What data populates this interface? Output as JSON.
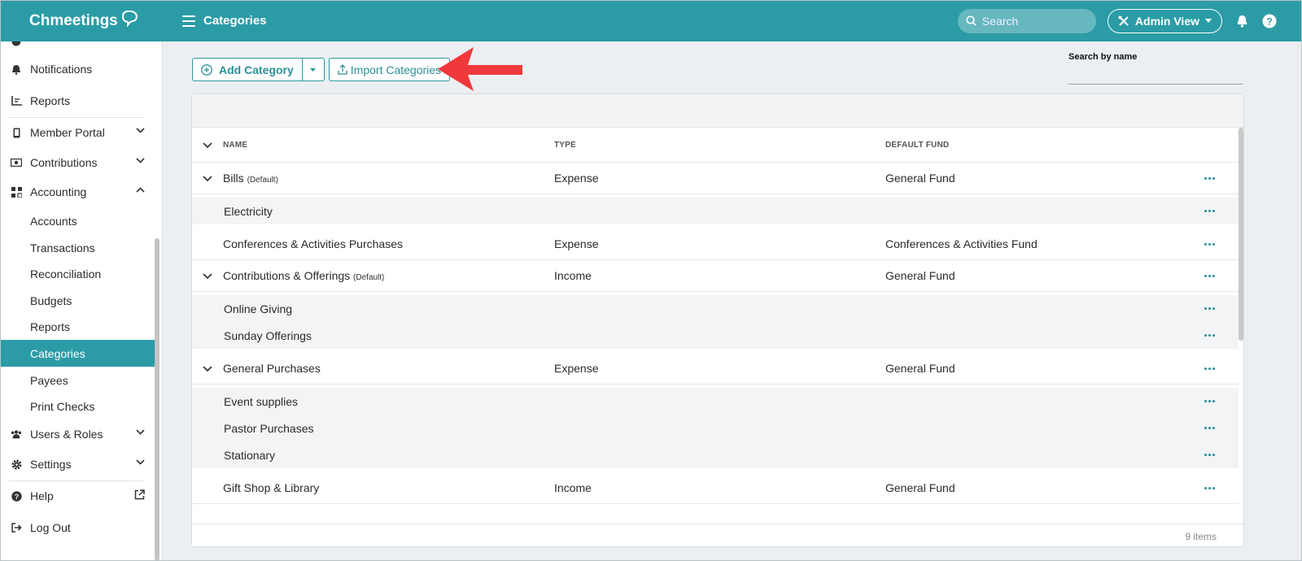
{
  "app": {
    "brand": "Chmeetings",
    "page_title": "Categories"
  },
  "topbar": {
    "search_placeholder": "Search",
    "admin_view_label": "Admin View"
  },
  "sidebar": {
    "items": [
      {
        "label": "Notifications",
        "icon": "bell-icon"
      },
      {
        "label": "Reports",
        "icon": "chart-icon"
      },
      {
        "label": "Member Portal",
        "icon": "phone-icon"
      },
      {
        "label": "Contributions",
        "icon": "cash-icon"
      },
      {
        "label": "Accounting",
        "icon": "grid-icon"
      }
    ],
    "accounting_sub": [
      "Accounts",
      "Transactions",
      "Reconciliation",
      "Budgets",
      "Reports",
      "Categories",
      "Payees",
      "Print Checks"
    ],
    "lower_items": [
      {
        "label": "Users & Roles",
        "icon": "users-icon"
      },
      {
        "label": "Settings",
        "icon": "gear-icon"
      },
      {
        "label": "Help",
        "icon": "help-icon"
      },
      {
        "label": "Log Out",
        "icon": "logout-icon"
      }
    ]
  },
  "toolbar": {
    "add_label": "Add Category",
    "import_label": "Import Categories"
  },
  "search_by_name": {
    "label": "Search by name",
    "value": ""
  },
  "table": {
    "headers": {
      "name": "NAME",
      "type": "TYPE",
      "fund": "DEFAULT FUND"
    },
    "rows": [
      {
        "kind": "parent",
        "name": "Bills",
        "tag": "(Default)",
        "type": "Expense",
        "fund": "General Fund",
        "expandable": true
      },
      {
        "kind": "child",
        "name": "Electricity",
        "type": "",
        "fund": ""
      },
      {
        "kind": "parent",
        "name": "Conferences & Activities Purchases",
        "tag": "",
        "type": "Expense",
        "fund": "Conferences & Activities Fund",
        "expandable": false
      },
      {
        "kind": "parent",
        "name": "Contributions & Offerings",
        "tag": "(Default)",
        "type": "Income",
        "fund": "General Fund",
        "expandable": true
      },
      {
        "kind": "child",
        "name": "Online Giving",
        "type": "",
        "fund": ""
      },
      {
        "kind": "child",
        "name": "Sunday Offerings",
        "type": "",
        "fund": ""
      },
      {
        "kind": "parent",
        "name": "General Purchases",
        "tag": "",
        "type": "Expense",
        "fund": "General Fund",
        "expandable": true
      },
      {
        "kind": "child",
        "name": "Event supplies",
        "type": "",
        "fund": ""
      },
      {
        "kind": "child",
        "name": "Pastor Purchases",
        "type": "",
        "fund": ""
      },
      {
        "kind": "child",
        "name": "Stationary",
        "type": "",
        "fund": ""
      },
      {
        "kind": "parent",
        "name": "Gift Shop & Library",
        "tag": "",
        "type": "Income",
        "fund": "General Fund",
        "expandable": false
      }
    ],
    "footer": "9 items"
  },
  "colors": {
    "accent": "#2b9ca6",
    "arrow": "#f0393b"
  }
}
